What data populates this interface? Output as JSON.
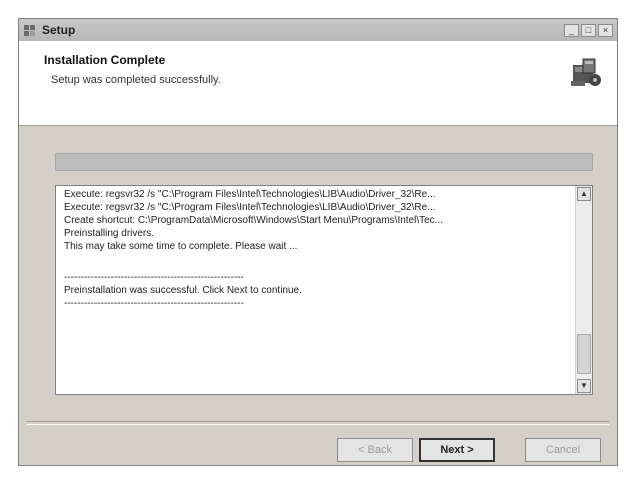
{
  "window": {
    "title": "Setup"
  },
  "header": {
    "title": "Installation Complete",
    "subtitle": "Setup was completed successfully."
  },
  "log": {
    "lines": [
      "Execute: regsvr32 /s \"C:\\Program Files\\Intel\\Technologies\\LIB\\Audio\\Driver_32\\Re...",
      "Execute: regsvr32 /s \"C:\\Program Files\\Intel\\Technologies\\LIB\\Audio\\Driver_32\\Re...",
      "Create shortcut: C:\\ProgramData\\Microsoft\\Windows\\Start Menu\\Programs\\Intel\\Tec...",
      "Preinstalling drivers.",
      "This may take some time to complete. Please wait ...",
      "",
      "------------------------------------------------------",
      "Preinstallation was successful. Click Next to continue.",
      "------------------------------------------------------"
    ]
  },
  "buttons": {
    "back": "< Back",
    "next": "Next >",
    "cancel": "Cancel"
  },
  "icons": {
    "app": "setup-icon",
    "header": "install-package-icon"
  },
  "colors": {
    "dialog_bg": "#d4d0c8",
    "header_bg": "#ffffff"
  }
}
